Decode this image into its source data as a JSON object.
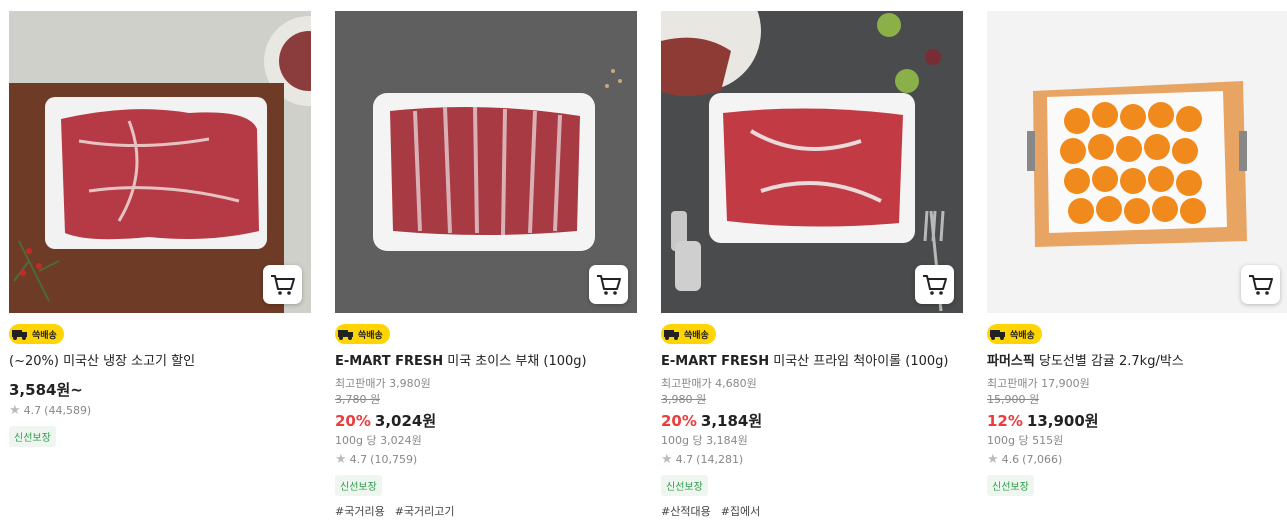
{
  "products": [
    {
      "title": "(~20%) 미국산 냉장 소고기 할인",
      "price": "3,584원~",
      "rating": "4.7",
      "reviews": "(44,589)",
      "tag": "신선보장",
      "badge": "쓱배송",
      "cart_icon": "cart-icon"
    },
    {
      "brand": "E-MART FRESH",
      "title": "미국 초이스 부채 (100g)",
      "max_price": "최고판매가 3,980원",
      "original_price": "3,780 원",
      "discount": "20%",
      "sale_price": "3,024원",
      "unit_price": "100g 당 3,024원",
      "rating": "4.7",
      "reviews": "(10,759)",
      "tag": "신선보장",
      "badge": "쓱배송",
      "hashtags": [
        "#국거리용",
        "#국거리고기"
      ]
    },
    {
      "brand": "E-MART FRESH",
      "title": "미국산 프라임 척아이롤 (100g)",
      "max_price": "최고판매가 4,680원",
      "original_price": "3,980 원",
      "discount": "20%",
      "sale_price": "3,184원",
      "unit_price": "100g 당 3,184원",
      "rating": "4.7",
      "reviews": "(14,281)",
      "tag": "신선보장",
      "badge": "쓱배송",
      "hashtags": [
        "#산적대용",
        "#집에서"
      ]
    },
    {
      "brand": "파머스픽",
      "title": "당도선별 감귤 2.7kg/박스",
      "max_price": "최고판매가 17,900원",
      "original_price": "15,900 원",
      "discount": "12%",
      "sale_price": "13,900원",
      "unit_price": "100g 당 515원",
      "rating": "4.6",
      "reviews": "(7,066)",
      "tag": "신선보장",
      "badge": "쓱배송"
    }
  ],
  "colors": {
    "accent_red": "#ea3d3d",
    "badge_yellow": "#ffd400",
    "fresh_green": "#2d9b4d"
  }
}
